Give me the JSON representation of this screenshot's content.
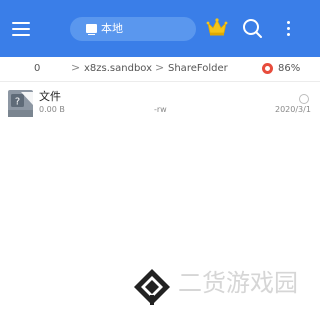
{
  "header": {
    "menu_icon": "hamburger-menu-icon",
    "location_label": "本地",
    "location_icon": "monitor-icon",
    "crown_icon": "crown-icon",
    "search_icon": "search-icon",
    "more_icon": "more-vertical-icon",
    "background_color": "#3a7ee8"
  },
  "breadcrumb": {
    "items": [
      "0",
      "x8zs.sandbox",
      "ShareFolder"
    ],
    "separator": ">"
  },
  "storage": {
    "icon": "storage-pie-icon",
    "percent_text": "86%",
    "percent_value": 86,
    "icon_color": "#e74c3c"
  },
  "files": [
    {
      "icon": "unknown-file-icon",
      "name": "文件",
      "size": "0.00 B",
      "permissions": "-rw",
      "date": "2020/3/1"
    }
  ],
  "watermark": {
    "logo_icon": "site-logo-icon",
    "text": "二货游戏园"
  }
}
